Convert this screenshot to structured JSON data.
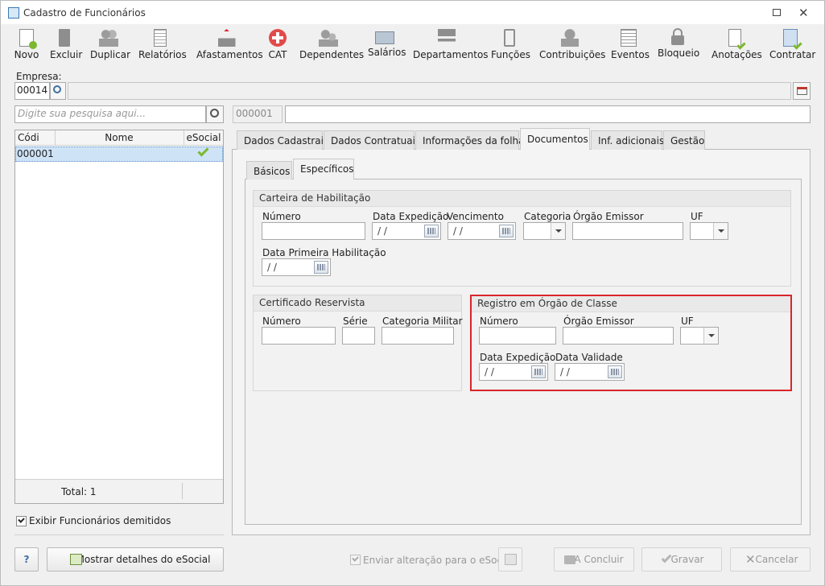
{
  "window": {
    "title": "Cadastro de Funcionários"
  },
  "toolbar": {
    "items": [
      "Novo",
      "Excluir",
      "Duplicar",
      "Relatórios",
      "Afastamentos",
      "CAT",
      "Dependentes",
      "Salários",
      "Departamentos",
      "Funções",
      "Contribuições",
      "Eventos",
      "Bloqueio",
      "Anotações",
      "Contratar"
    ]
  },
  "empresa": {
    "label": "Empresa:",
    "code": "00014",
    "name": ""
  },
  "search": {
    "placeholder": "Digite sua pesquisa aqui..."
  },
  "employee_header": {
    "code": "000001",
    "name": ""
  },
  "list": {
    "columns": [
      "Códi",
      "Nome",
      "eSocial"
    ],
    "rows": [
      {
        "code": "000001",
        "name": ""
      }
    ],
    "total": "Total: 1"
  },
  "show_dismissed": "Exibir Funcionários demitidos",
  "tabs": [
    "Dados Cadastrais",
    "Dados Contratuais",
    "Informações da folha",
    "Documentos",
    "Inf. adicionais",
    "Gestão"
  ],
  "subtabs": [
    "Básicos",
    "Específicos"
  ],
  "cnh": {
    "title": "Carteira de Habilitação",
    "numero": "Número",
    "data_expedicao": "Data Expedição",
    "vencimento": "Vencimento",
    "categoria": "Categoria",
    "orgao_emissor": "Órgão Emissor",
    "uf": "UF",
    "data_primeira": "Data Primeira Habilitação",
    "date_placeholder": "/ /"
  },
  "reservista": {
    "title": "Certificado Reservista",
    "numero": "Número",
    "serie": "Série",
    "categoria_militar": "Categoria Militar"
  },
  "registro": {
    "title": "Registro em Órgão de Classe",
    "numero": "Número",
    "orgao_emissor": "Órgão Emissor",
    "uf": "UF",
    "data_expedicao": "Data Expedição",
    "data_validade": "Data Validade",
    "date_placeholder": "/ /"
  },
  "footer": {
    "help": "?",
    "esocial_details": "Mostrar detalhes do eSocial",
    "send_change": "Enviar alteração para o eSocial",
    "concluir": "A Concluir",
    "gravar": "Gravar",
    "cancelar": "Cancelar"
  },
  "colors": {
    "highlight": "#d9252b",
    "selection": "#cfe3f7",
    "check": "#7cb82f"
  }
}
